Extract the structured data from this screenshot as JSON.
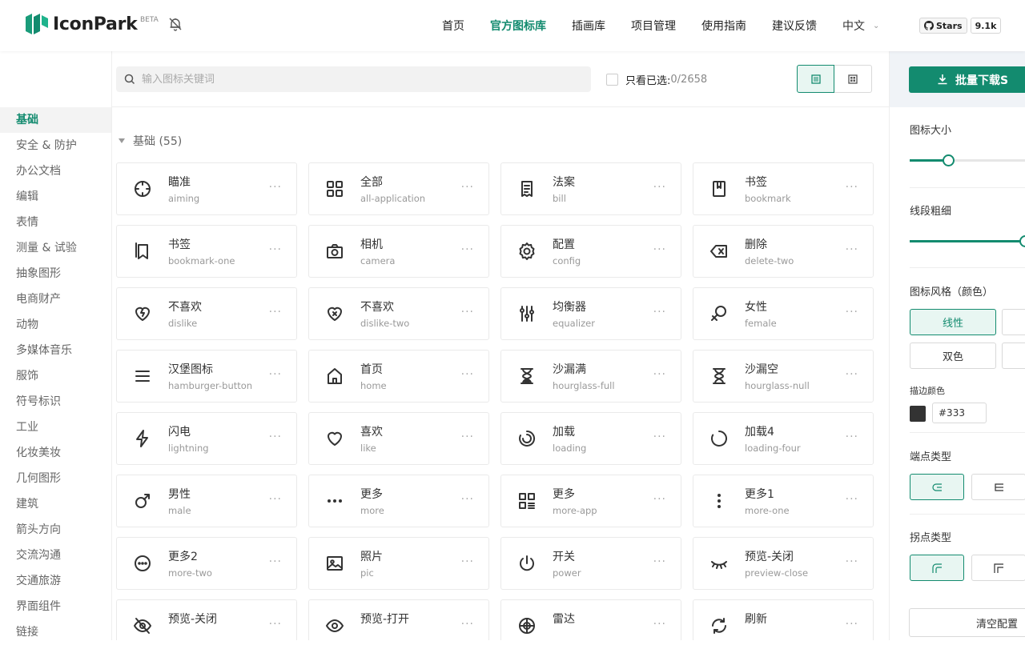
{
  "header": {
    "logo_text": "IconPark",
    "beta": "BETA",
    "nav": [
      "首页",
      "官方图标库",
      "插画库",
      "项目管理",
      "使用指南",
      "建议反馈"
    ],
    "nav_active": 1,
    "lang": "中文",
    "github": {
      "label": "Stars",
      "count": "9.1k"
    }
  },
  "search": {
    "placeholder": "输入图标关键词",
    "filter_label": "只看已选:",
    "count": "0/2658"
  },
  "sidebar": {
    "items": [
      "基础",
      "安全 & 防护",
      "办公文档",
      "编辑",
      "表情",
      "测量 & 试验",
      "抽象图形",
      "电商财产",
      "动物",
      "多媒体音乐",
      "服饰",
      "符号标识",
      "工业",
      "化妆美妆",
      "几何图形",
      "建筑",
      "箭头方向",
      "交流沟通",
      "交通旅游",
      "界面组件",
      "链接"
    ]
  },
  "section": {
    "title": "基础 (55)"
  },
  "icons": [
    {
      "cn": "瞄准",
      "en": "aiming",
      "icon": "aiming-icon"
    },
    {
      "cn": "全部",
      "en": "all-application",
      "icon": "all-application-icon"
    },
    {
      "cn": "法案",
      "en": "bill",
      "icon": "bill-icon"
    },
    {
      "cn": "书签",
      "en": "bookmark",
      "icon": "bookmark-icon"
    },
    {
      "cn": "书签",
      "en": "bookmark-one",
      "icon": "bookmark-one-icon"
    },
    {
      "cn": "相机",
      "en": "camera",
      "icon": "camera-icon"
    },
    {
      "cn": "配置",
      "en": "config",
      "icon": "config-icon"
    },
    {
      "cn": "删除",
      "en": "delete-two",
      "icon": "delete-two-icon"
    },
    {
      "cn": "不喜欢",
      "en": "dislike",
      "icon": "dislike-icon"
    },
    {
      "cn": "不喜欢",
      "en": "dislike-two",
      "icon": "dislike-two-icon"
    },
    {
      "cn": "均衡器",
      "en": "equalizer",
      "icon": "equalizer-icon"
    },
    {
      "cn": "女性",
      "en": "female",
      "icon": "female-icon"
    },
    {
      "cn": "汉堡图标",
      "en": "hamburger-button",
      "icon": "hamburger-button-icon"
    },
    {
      "cn": "首页",
      "en": "home",
      "icon": "home-icon"
    },
    {
      "cn": "沙漏满",
      "en": "hourglass-full",
      "icon": "hourglass-full-icon"
    },
    {
      "cn": "沙漏空",
      "en": "hourglass-null",
      "icon": "hourglass-null-icon"
    },
    {
      "cn": "闪电",
      "en": "lightning",
      "icon": "lightning-icon"
    },
    {
      "cn": "喜欢",
      "en": "like",
      "icon": "like-icon"
    },
    {
      "cn": "加载",
      "en": "loading",
      "icon": "loading-icon"
    },
    {
      "cn": "加载4",
      "en": "loading-four",
      "icon": "loading-four-icon"
    },
    {
      "cn": "男性",
      "en": "male",
      "icon": "male-icon"
    },
    {
      "cn": "更多",
      "en": "more",
      "icon": "more-icon"
    },
    {
      "cn": "更多",
      "en": "more-app",
      "icon": "more-app-icon"
    },
    {
      "cn": "更多1",
      "en": "more-one",
      "icon": "more-one-icon"
    },
    {
      "cn": "更多2",
      "en": "more-two",
      "icon": "more-two-icon"
    },
    {
      "cn": "照片",
      "en": "pic",
      "icon": "pic-icon"
    },
    {
      "cn": "开关",
      "en": "power",
      "icon": "power-icon"
    },
    {
      "cn": "预览-关闭",
      "en": "preview-close",
      "icon": "preview-close-icon"
    },
    {
      "cn": "预览-关闭",
      "en": "",
      "icon": "preview-close-one-icon"
    },
    {
      "cn": "预览-打开",
      "en": "",
      "icon": "preview-open-icon"
    },
    {
      "cn": "雷达",
      "en": "",
      "icon": "radar-icon"
    },
    {
      "cn": "刷新",
      "en": "",
      "icon": "refresh-icon"
    }
  ],
  "card_more": "···",
  "panel": {
    "download_label": "批量下载S",
    "size_label": "图标大小",
    "size_value": 0.3,
    "stroke_label": "线段粗细",
    "stroke_value": 0.9,
    "style_label": "图标风格（颜色）",
    "style_options": [
      "线性",
      "双色"
    ],
    "stroke_color_label": "描边颜色",
    "stroke_color": "#333",
    "cap_label": "端点类型",
    "join_label": "拐点类型",
    "clear_label": "清空配置"
  },
  "colors": {
    "accent": "#138b6f",
    "accent_bg": "#e8f6f2",
    "icon": "#333333"
  }
}
